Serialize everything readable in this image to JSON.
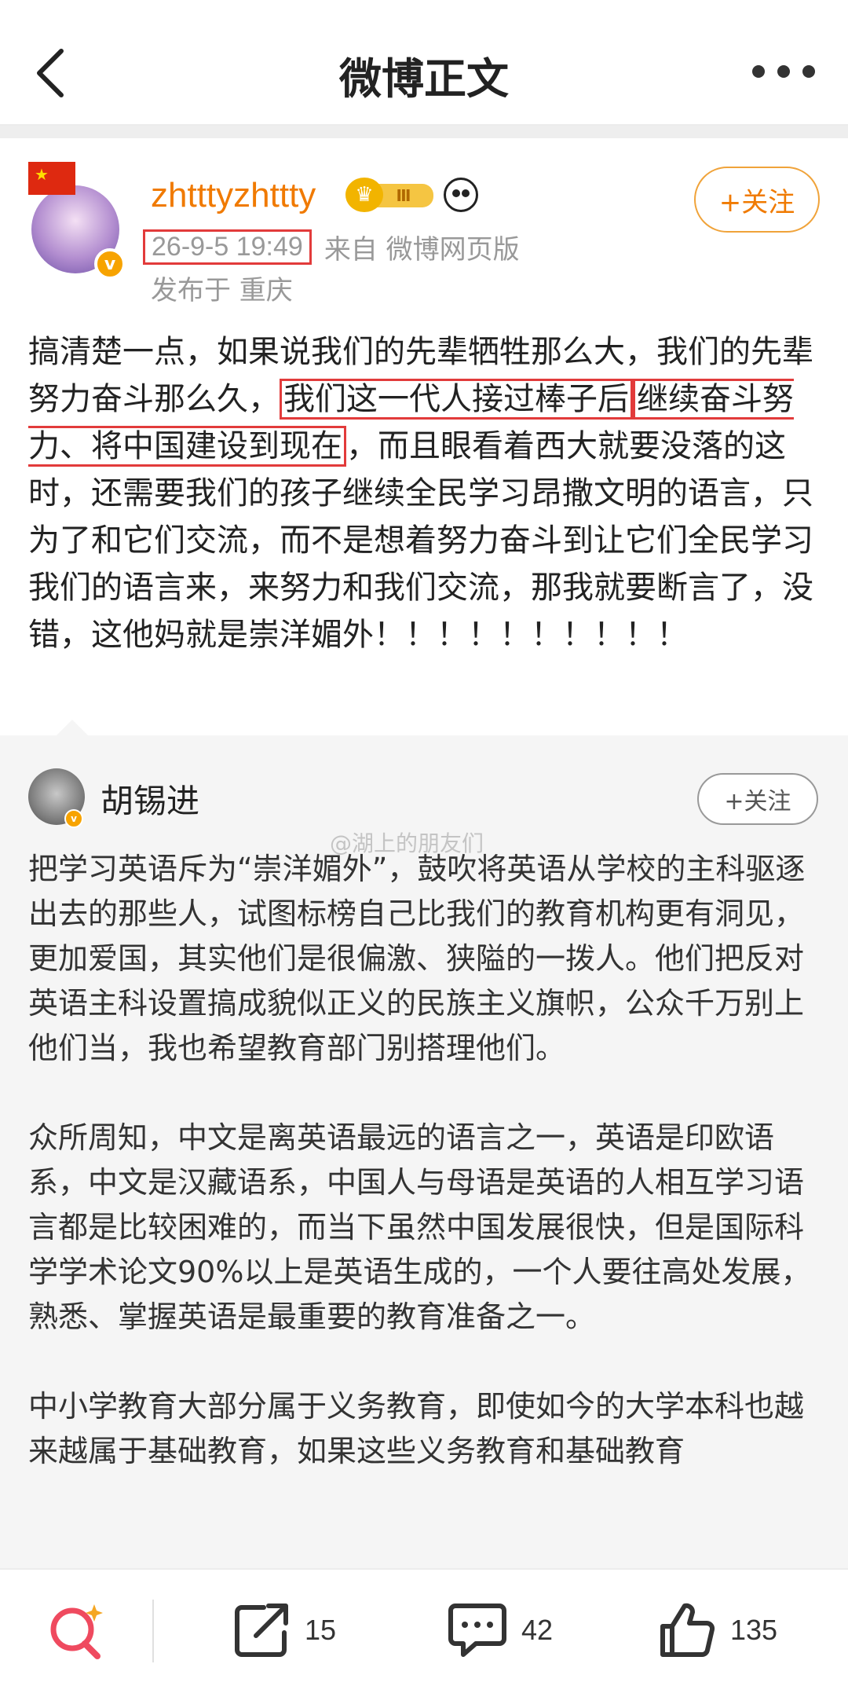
{
  "header": {
    "title": "微博正文"
  },
  "post": {
    "username": "zhtttyzhttty",
    "vip_level": "Ⅲ",
    "follow_label": "+关注",
    "time": "26-9-5 19:49",
    "source": "来自 微博网页版",
    "location": "发布于 重庆",
    "content_pre": "搞清楚一点，如果说我们的先辈牺牲那么大，我们的先辈努力奋斗那么久，",
    "content_hl1": "我们这一代人接过棒子后",
    "content_hl2": "继续奋斗努力、将中国建设到现在",
    "content_post": "，而且眼看着西大就要没落的这时，还需要我们的孩子继续全民学习昂撒文明的语言，只为了和它们交流，而不是想着努力奋斗到让它们全民学习我们的语言来，来努力和我们交流，那我就要断言了，没错，这他妈就是崇洋媚外！！！！！！！！！！"
  },
  "repost": {
    "username": "胡锡进",
    "follow_label": "+关注",
    "watermark": "@湖上的朋友们",
    "content": "把学习英语斥为“崇洋媚外”，鼓吹将英语从学校的主科驱逐出去的那些人，试图标榜自己比我们的教育机构更有洞见，更加爱国，其实他们是很偏激、狭隘的一拨人。他们把反对英语主科设置搞成貌似正义的民族主义旗帜，公众千万别上他们当，我也希望教育部门别搭理他们。\n\n众所周知，中文是离英语最远的语言之一，英语是印欧语系，中文是汉藏语系，中国人与母语是英语的人相互学习语言都是比较困难的，而当下虽然中国发展很快，但是国际科学学术论文90%以上是英语生成的，一个人要往高处发展，熟悉、掌握英语是最重要的教育准备之一。\n\n中小学教育大部分属于义务教育，即使如今的大学本科也越来越属于基础教育，如果这些义务教育和基础教育"
  },
  "actions": {
    "repost_count": "15",
    "comment_count": "42",
    "like_count": "135"
  },
  "colors": {
    "accent": "#f07a00",
    "highlight": "#e23b3b"
  }
}
